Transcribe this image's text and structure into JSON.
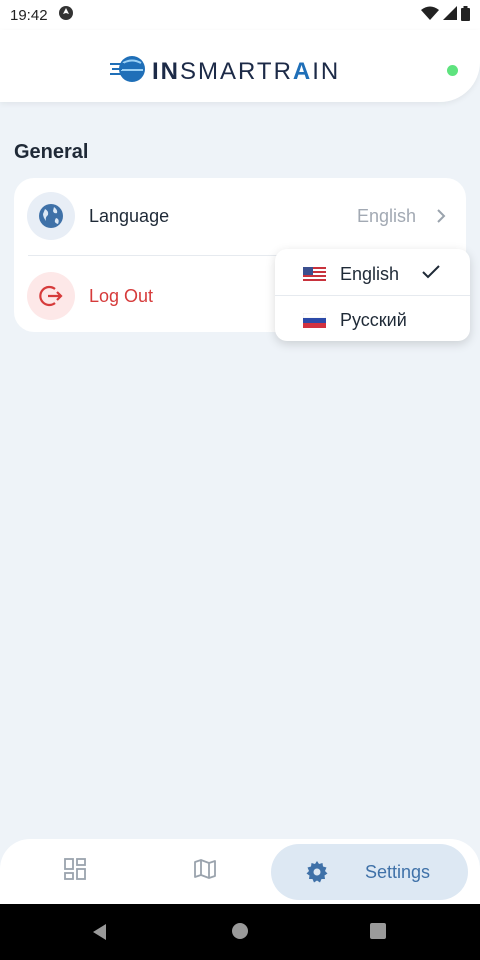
{
  "status": {
    "time": "19:42",
    "icons": [
      "app-notification-icon",
      "wifi-icon",
      "signal-icon",
      "battery-icon"
    ]
  },
  "header": {
    "logo_bold": "IN",
    "logo_light": "SMARTR",
    "logo_a": "A",
    "logo_tail": "IN",
    "connection_status_color": "#5ee37e"
  },
  "section": {
    "title": "General"
  },
  "settings": {
    "language_label": "Language",
    "language_value": "English",
    "logout_label": "Log Out"
  },
  "dropdown": {
    "options": [
      {
        "label": "English",
        "flag": "us-flag-icon",
        "selected": true
      },
      {
        "label": "Русский",
        "flag": "ru-flag-icon",
        "selected": false
      }
    ]
  },
  "bottom_nav": {
    "items": [
      {
        "name": "dashboard",
        "icon": "dashboard-icon"
      },
      {
        "name": "map",
        "icon": "map-icon"
      },
      {
        "name": "settings",
        "icon": "gear-icon",
        "label": "Settings",
        "active": true
      }
    ]
  },
  "colors": {
    "accent": "#3f71a8",
    "danger": "#d63b3b",
    "background": "#eef3f8"
  }
}
